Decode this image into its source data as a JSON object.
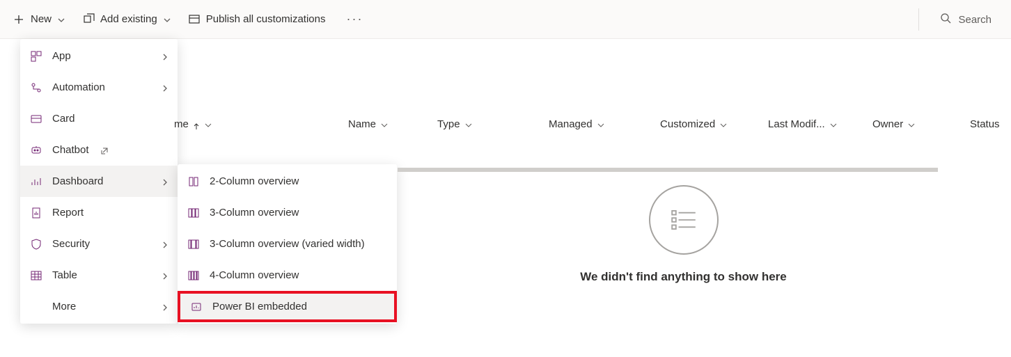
{
  "toolbar": {
    "new_label": "New",
    "add_existing_label": "Add existing",
    "publish_label": "Publish all customizations",
    "search_placeholder": "Search"
  },
  "new_menu": {
    "items": [
      {
        "label": "App",
        "icon": "app-icon",
        "chevron": true
      },
      {
        "label": "Automation",
        "icon": "automation-icon",
        "chevron": true
      },
      {
        "label": "Card",
        "icon": "card-icon",
        "chevron": false
      },
      {
        "label": "Chatbot",
        "icon": "chatbot-icon",
        "chevron": false,
        "external": true
      },
      {
        "label": "Dashboard",
        "icon": "dashboard-icon",
        "chevron": true,
        "active": true
      },
      {
        "label": "Report",
        "icon": "report-icon",
        "chevron": false
      },
      {
        "label": "Security",
        "icon": "security-icon",
        "chevron": true
      },
      {
        "label": "Table",
        "icon": "table-icon",
        "chevron": true
      },
      {
        "label": "More",
        "icon": "",
        "chevron": true
      }
    ]
  },
  "dashboard_submenu": {
    "items": [
      {
        "label": "2-Column overview",
        "icon": "col2-icon"
      },
      {
        "label": "3-Column overview",
        "icon": "col3-icon"
      },
      {
        "label": "3-Column overview (varied width)",
        "icon": "col3v-icon"
      },
      {
        "label": "4-Column overview",
        "icon": "col4-icon"
      },
      {
        "label": "Power BI embedded",
        "icon": "powerbi-icon",
        "highlight": true,
        "hover": true
      }
    ]
  },
  "table": {
    "columns": [
      {
        "label": "me",
        "sort": "asc"
      },
      {
        "label": "Name"
      },
      {
        "label": "Type"
      },
      {
        "label": "Managed"
      },
      {
        "label": "Customized"
      },
      {
        "label": "Last Modif..."
      },
      {
        "label": "Owner"
      },
      {
        "label": "Status"
      }
    ],
    "empty_message": "We didn't find anything to show here"
  },
  "colors": {
    "accent": "#742774",
    "highlight": "#e81123"
  }
}
